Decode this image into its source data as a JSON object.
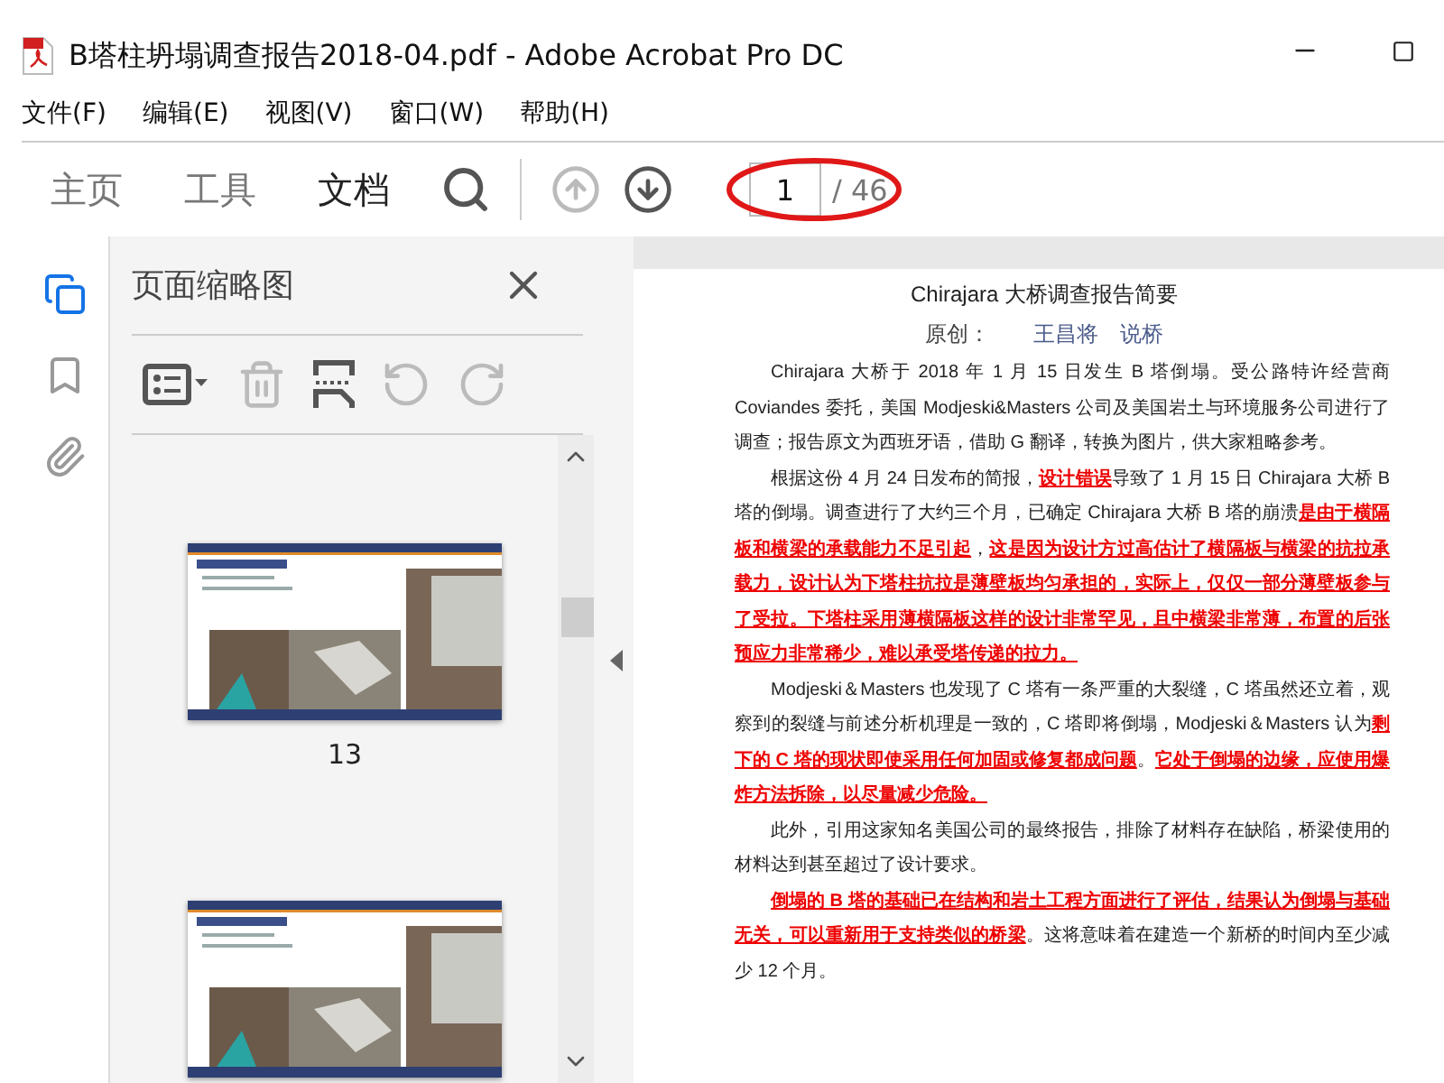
{
  "window": {
    "title": "B塔柱坍塌调查报告2018-04.pdf - Adobe Acrobat Pro DC"
  },
  "menu": [
    "文件(F)",
    "编辑(E)",
    "视图(V)",
    "窗口(W)",
    "帮助(H)"
  ],
  "tabs": [
    {
      "label": "主页",
      "selected": false
    },
    {
      "label": "工具",
      "selected": false
    },
    {
      "label": "文档",
      "selected": true
    }
  ],
  "navigation": [
    {
      "kind": "up",
      "disabled": true
    },
    {
      "kind": "down",
      "disabled": false
    }
  ],
  "page_field": {
    "value": "1",
    "total": "/ 46",
    "annotated": true
  },
  "side_rail": [
    {
      "kind": "pages",
      "selected": true
    },
    {
      "kind": "bookmarks",
      "selected": false
    },
    {
      "kind": "attachments",
      "selected": false
    }
  ],
  "panel": {
    "title": "页面缩略图",
    "tools": [
      {
        "kind": "options",
        "disabled": false
      },
      {
        "kind": "delete",
        "disabled": true
      },
      {
        "kind": "insert",
        "disabled": false
      },
      {
        "kind": "rotate-left",
        "disabled": true
      },
      {
        "kind": "rotate-right",
        "disabled": true
      }
    ],
    "thumbnails": [
      {
        "kind": "picture",
        "label": "13"
      },
      {
        "kind": "picture"
      }
    ]
  },
  "document": {
    "title": "Chirajara 大桥调查报告简要",
    "byline_label": "原创：",
    "authors": "王昌将　说桥",
    "paragraphs": [
      [
        {
          "text": "Chirajara 大桥于 2018 年 1 月 15 日发生 B 塔倒塌。受公路特许经营商 Coviandes 委托，美国 Modjeski&Masters 公司及美国岩土与环境服务公司进行了调查；报告原文为西班牙语，借助 G 翻译，转换为图片，供大家粗略参考。",
          "marked": false
        }
      ],
      [
        {
          "text": "根据这份 4 月 24 日发布的简报，",
          "marked": false
        },
        {
          "text": "设计错误",
          "marked": true
        },
        {
          "text": "导致了 1 月 15 日 Chirajara 大桥 B 塔的倒塌。调查进行了大约三个月，已确定 Chirajara 大桥 B 塔的崩溃",
          "marked": false
        },
        {
          "text": "是由于横隔板和横梁的承载能力不足引起",
          "marked": true
        },
        {
          "text": "，",
          "marked": false
        },
        {
          "text": "这是因为设计方过高估计了横隔板与横梁的抗拉承载力，设计认为下塔柱抗拉是薄壁板均匀承担的，实际上，仅仅一部分薄壁板参与了受拉。下塔柱采用薄横隔板这样的设计非常罕见，且中横梁非常薄，布置的后张预应力非常稀少，难以承受塔传递的拉力。",
          "marked": true
        }
      ],
      [
        {
          "text": "Modjeski＆Masters 也发现了 C 塔有一条严重的大裂缝，C 塔虽然还立着，观察到的裂缝与前述分析机理是一致的，C 塔即将倒塌，Modjeski＆Masters 认为",
          "marked": false
        },
        {
          "text": "剩下的 C 塔的现状即使采用任何加固或修复都成问题",
          "marked": true
        },
        {
          "text": "。",
          "marked": false
        },
        {
          "text": "它处于倒塌的边缘，应使用爆炸方法拆除，以尽量减少危险。",
          "marked": true
        }
      ],
      [
        {
          "text": "此外，引用这家知名美国公司的最终报告，排除了材料存在缺陷，桥梁使用的材料达到甚至超过了设计要求。",
          "marked": false
        }
      ],
      [
        {
          "text": "倒塌的 B 塔的基础已在结构和岩土工程方面进行了评估，结果认为倒塌与基础无关，可以重新用于支持类似的桥梁",
          "marked": true
        },
        {
          "text": "。这将意味着在建造一个新桥的时间内至少减少 12 个月。",
          "marked": false
        }
      ]
    ]
  }
}
